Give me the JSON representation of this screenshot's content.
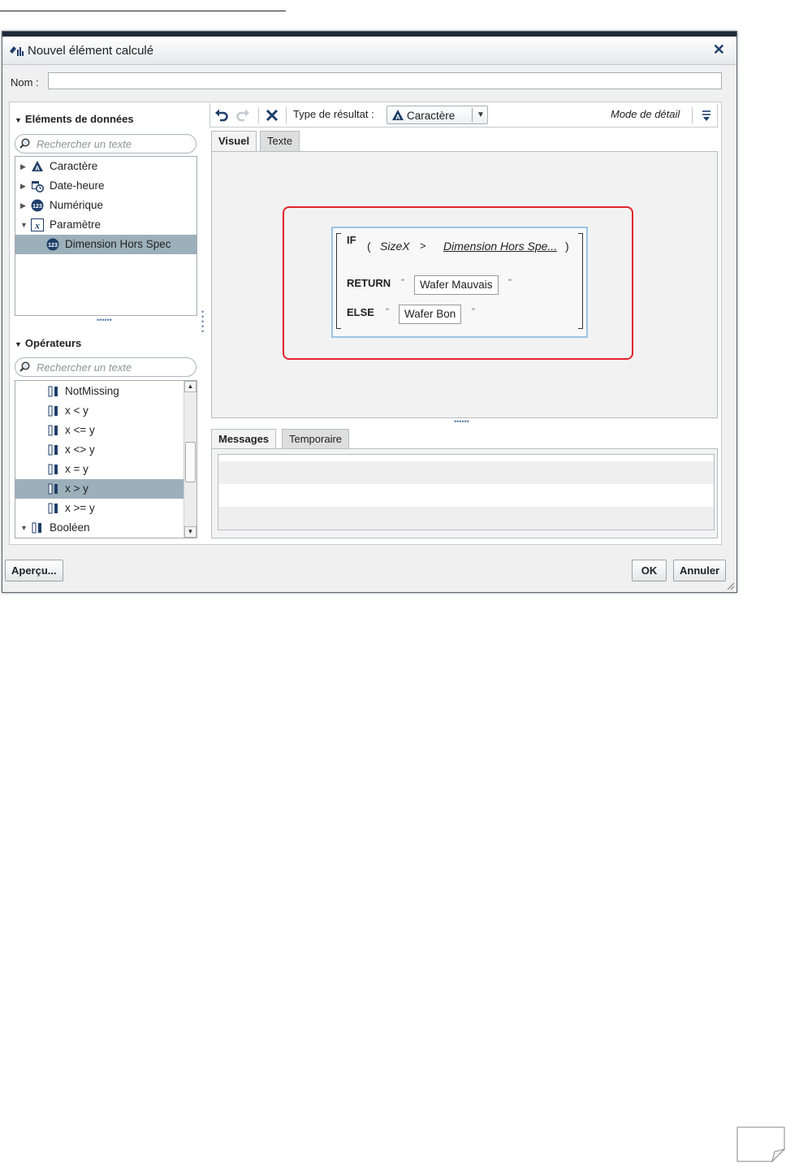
{
  "dialog": {
    "title": "Nouvel élément calculé",
    "name_label": "Nom :",
    "name_value": ""
  },
  "left_panel": {
    "data_items": {
      "title": "Eléments de données",
      "search_placeholder": "Rechercher un texte",
      "items": [
        {
          "label": "Caractère",
          "icon": "character-icon",
          "expanded": false
        },
        {
          "label": "Date-heure",
          "icon": "datetime-icon",
          "expanded": false
        },
        {
          "label": "Numérique",
          "icon": "numeric-icon",
          "expanded": false
        },
        {
          "label": "Paramètre",
          "icon": "parameter-icon",
          "expanded": true
        },
        {
          "label": "Dimension Hors Spec",
          "icon": "numeric-parameter-icon",
          "selected": true
        }
      ]
    },
    "operators": {
      "title": "Opérateurs",
      "search_placeholder": "Rechercher un texte",
      "items": [
        {
          "label": "NotMissing"
        },
        {
          "label": "x < y"
        },
        {
          "label": "x <= y"
        },
        {
          "label": "x <> y"
        },
        {
          "label": "x = y"
        },
        {
          "label": "x > y",
          "selected": true
        },
        {
          "label": "x >= y"
        },
        {
          "label": "Booléen",
          "expanded": true
        }
      ]
    }
  },
  "toolbar": {
    "result_type_label": "Type de résultat :",
    "result_type_value": "Caractère",
    "mode_label": "Mode de détail"
  },
  "editor_tabs": {
    "visual": "Visuel",
    "text": "Texte",
    "active": "Visuel"
  },
  "expression": {
    "if_kw": "IF",
    "open_paren": "(",
    "left_operand": "SizeX",
    "operator": ">",
    "right_operand": "Dimension Hors Spe...",
    "close_paren": ")",
    "return_kw": "RETURN",
    "return_value": "Wafer Mauvais",
    "else_kw": "ELSE",
    "else_value": "Wafer Bon",
    "quote": "\""
  },
  "bottom_tabs": {
    "messages": "Messages",
    "temporary": "Temporaire",
    "active": "Messages"
  },
  "footer": {
    "preview": "Aperçu...",
    "ok": "OK",
    "cancel": "Annuler"
  },
  "colors": {
    "highlight": "#e0242b",
    "selection": "#9cb0bb",
    "accent": "#1f3f6a"
  }
}
